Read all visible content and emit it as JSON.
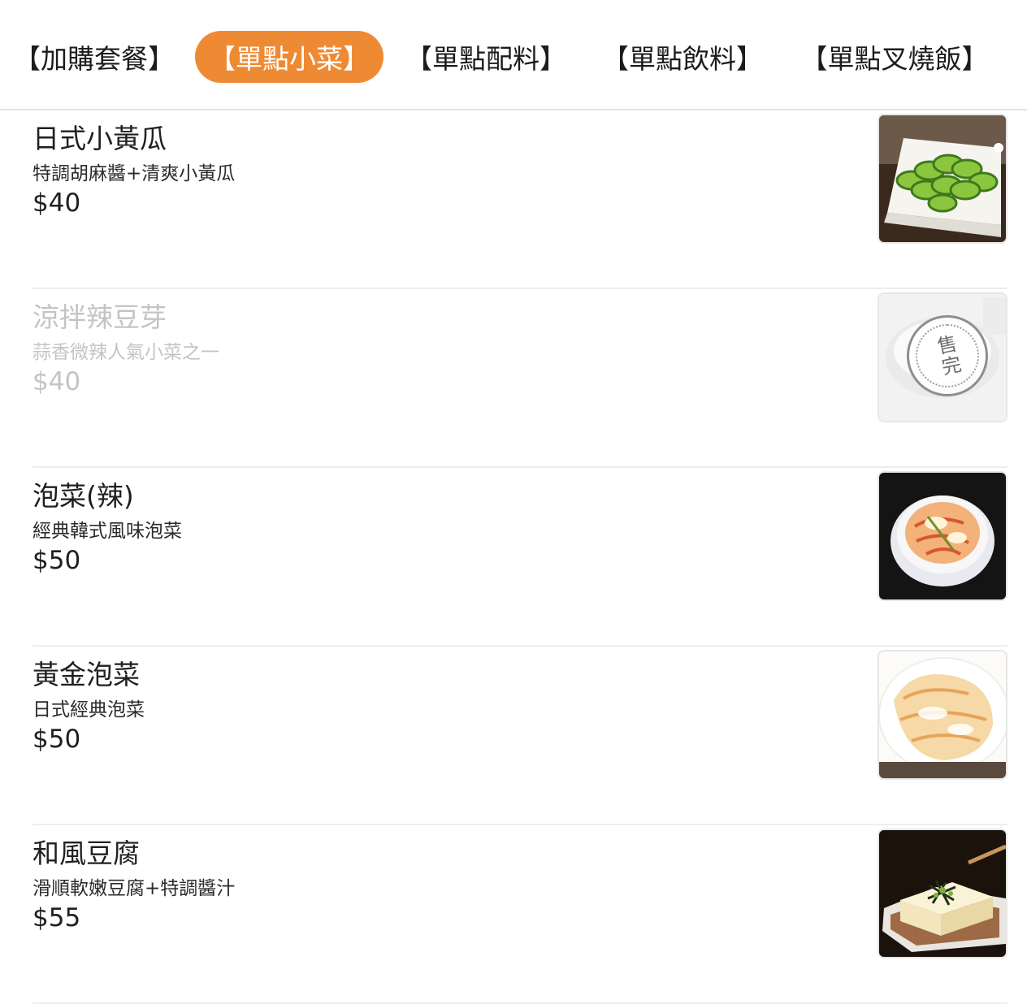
{
  "tabs": [
    {
      "label": "【加購套餐】",
      "active": false
    },
    {
      "label": "【單點小菜】",
      "active": true
    },
    {
      "label": "【單點配料】",
      "active": false
    },
    {
      "label": "【單點飲料】",
      "active": false
    },
    {
      "label": "【單點叉燒飯】",
      "active": false
    }
  ],
  "accent_color": "#ef8a34",
  "items": [
    {
      "name": "日式小黃瓜",
      "desc": "特調胡麻醬+清爽小黃瓜",
      "price": "$40",
      "image": "cucumber-salad-photo"
    },
    {
      "name": "涼拌辣豆芽",
      "desc": "蒜香微辣人氣小菜之一",
      "price": "$40",
      "image": "spicy-bean-sprouts-photo",
      "sold_out_label": "售完"
    },
    {
      "name": "泡菜(辣)",
      "desc": "經典韓式風味泡菜",
      "price": "$50",
      "image": "kimchi-bowl-photo"
    },
    {
      "name": "黃金泡菜",
      "desc": "日式經典泡菜",
      "price": "$50",
      "image": "golden-kimchi-photo"
    },
    {
      "name": "和風豆腐",
      "desc": "滑順軟嫩豆腐+特調醬汁",
      "price": "$55",
      "image": "japanese-tofu-photo"
    }
  ]
}
